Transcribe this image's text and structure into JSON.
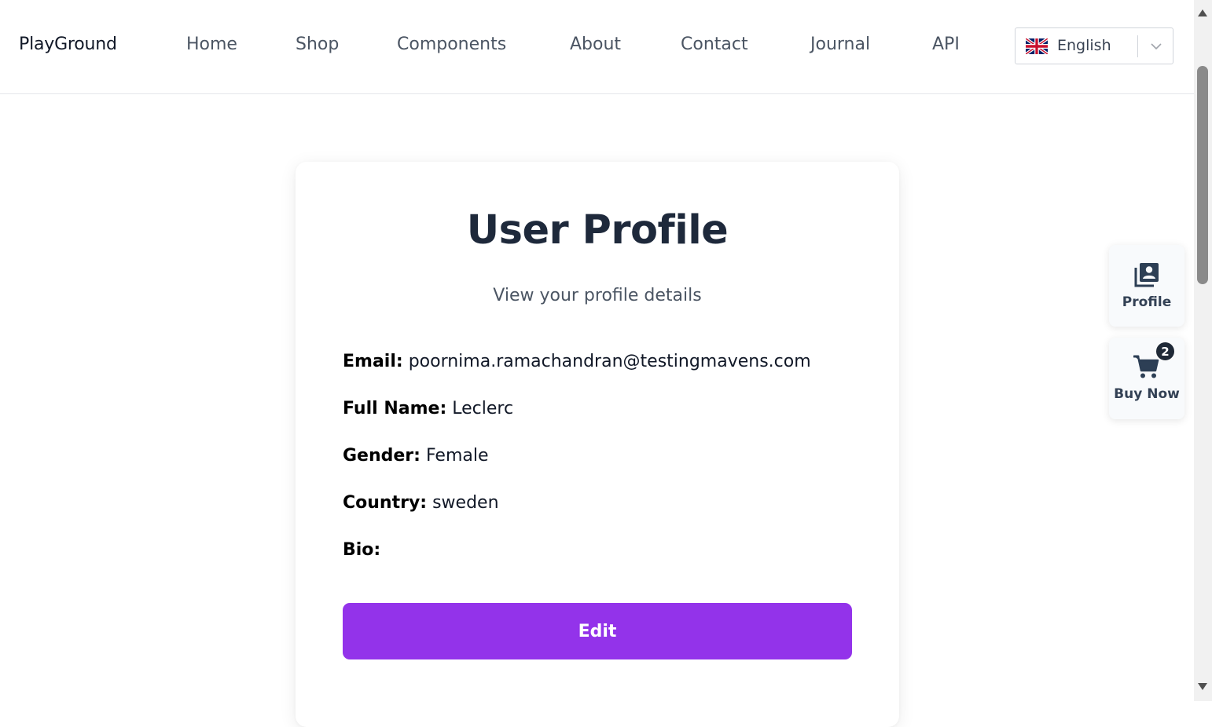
{
  "header": {
    "brand": "PlayGround",
    "nav": [
      "Home",
      "Shop",
      "Components",
      "About",
      "Contact",
      "Journal",
      "API"
    ],
    "language": {
      "selected": "English",
      "flag_icon": "uk-flag-icon"
    }
  },
  "profile": {
    "title": "User Profile",
    "subtitle": "View your profile details",
    "fields": [
      {
        "label": "Email:",
        "value": "poornima.ramachandran@testingmavens.com"
      },
      {
        "label": "Full Name:",
        "value": "Leclerc"
      },
      {
        "label": "Gender:",
        "value": "Female"
      },
      {
        "label": "Country:",
        "value": "sweden"
      },
      {
        "label": "Bio:",
        "value": ""
      }
    ],
    "edit_label": "Edit"
  },
  "widgets": {
    "profile_label": "Profile",
    "buy_label": "Buy Now",
    "cart_count": "2"
  },
  "colors": {
    "accent": "#9333ea",
    "heading": "#1e293b",
    "muted": "#4b5563"
  }
}
